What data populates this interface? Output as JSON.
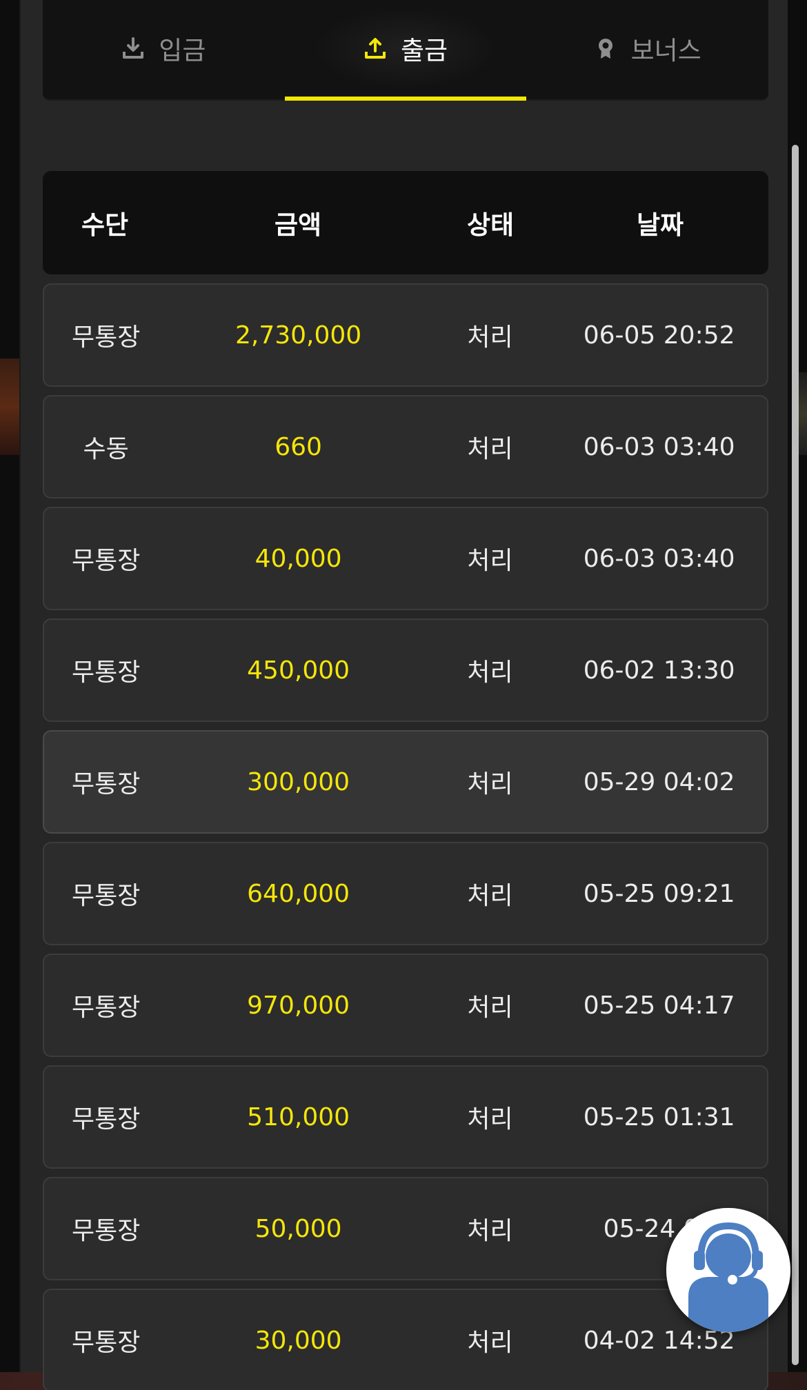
{
  "tabs": [
    {
      "label": "입금",
      "icon": "download-icon",
      "active": false
    },
    {
      "label": "출금",
      "icon": "upload-icon",
      "active": true
    },
    {
      "label": "보너스",
      "icon": "award-icon",
      "active": false
    }
  ],
  "colors": {
    "accent": "#f2e600",
    "amount": "#f5e60a",
    "panel": "#262626",
    "header_bg": "#0f0f0f"
  },
  "table": {
    "headers": [
      "수단",
      "금액",
      "상태",
      "날짜"
    ],
    "rows": [
      {
        "method": "무통장",
        "amount": "2,730,000",
        "status": "처리",
        "date": "06-05 20:52"
      },
      {
        "method": "수동",
        "amount": "660",
        "status": "처리",
        "date": "06-03 03:40"
      },
      {
        "method": "무통장",
        "amount": "40,000",
        "status": "처리",
        "date": "06-03 03:40"
      },
      {
        "method": "무통장",
        "amount": "450,000",
        "status": "처리",
        "date": "06-02 13:30"
      },
      {
        "method": "무통장",
        "amount": "300,000",
        "status": "처리",
        "date": "05-29 04:02"
      },
      {
        "method": "무통장",
        "amount": "640,000",
        "status": "처리",
        "date": "05-25 09:21"
      },
      {
        "method": "무통장",
        "amount": "970,000",
        "status": "처리",
        "date": "05-25 04:17"
      },
      {
        "method": "무통장",
        "amount": "510,000",
        "status": "처리",
        "date": "05-25 01:31"
      },
      {
        "method": "무통장",
        "amount": "50,000",
        "status": "처리",
        "date": "05-24 07"
      },
      {
        "method": "무통장",
        "amount": "30,000",
        "status": "처리",
        "date": "04-02 14:52"
      }
    ]
  },
  "support": {
    "icon": "customer-support-icon"
  }
}
